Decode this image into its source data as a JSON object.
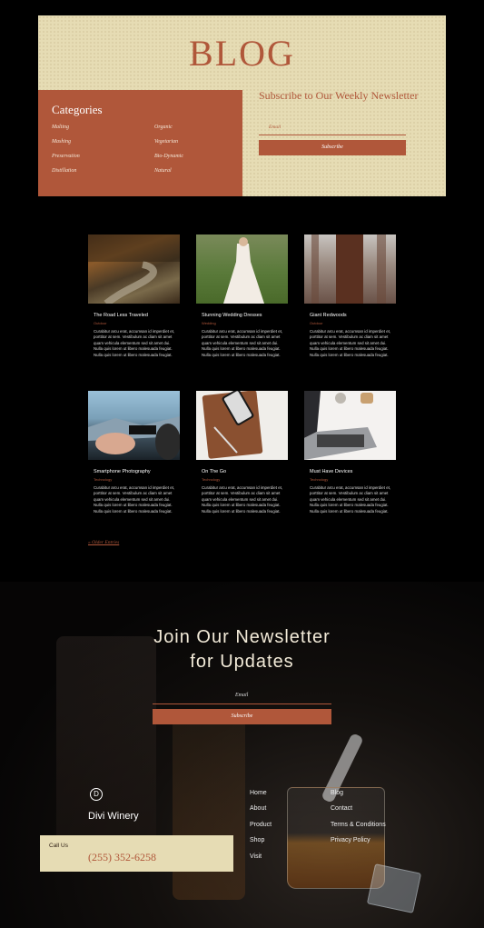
{
  "hero": {
    "title": "BLOG",
    "categories_title": "Categories",
    "categories": [
      "Malting",
      "Mashing",
      "Preservation",
      "Distillation",
      "Organic",
      "Vegetarian",
      "Bio-Dynamic",
      "Natural"
    ],
    "subscribe_title": "Subscribe to Our Weekly Newsletter",
    "email_placeholder": "Email",
    "subscribe_label": "Subscribe"
  },
  "posts": [
    {
      "title": "The Road Less Traveled",
      "category": "Outdoor",
      "image": "forest-path-photo"
    },
    {
      "title": "Stunning Wedding Dresses",
      "category": "Wedding",
      "image": "wedding-dress-photo"
    },
    {
      "title": "Giant Redwoods",
      "category": "Outdoor",
      "image": "redwood-forest-photo"
    },
    {
      "title": "Smartphone Photography",
      "category": "Technology",
      "image": "smartphone-photo"
    },
    {
      "title": "On The Go",
      "category": "Technology",
      "image": "phone-notebook-photo"
    },
    {
      "title": "Must Have Devices",
      "category": "Technology",
      "image": "laptop-photo"
    }
  ],
  "post_excerpt": "Curabitur arcu erat, accumsan id imperdiet et, porttitor at sem. Vestibulum ac diam sit amet quam vehicula elementum sed sit amet dui. Nulla quis lorem ut libero malesuada feugiat. Nulla quis lorem ut libero malesuada feugiat.",
  "older_entries": "« Older Entries",
  "newsletter": {
    "title_line1": "Join Our Newsletter",
    "title_line2": "for Updates",
    "email_placeholder": "Email",
    "subscribe_label": "Subscribe"
  },
  "footer": {
    "logo_letter": "D",
    "brand": "Divi Winery",
    "call_label": "Call Us",
    "phone": "(255) 352-6258",
    "links_col1": [
      "Home",
      "About",
      "Product",
      "Shop",
      "Visit"
    ],
    "links_col2": [
      "Blog",
      "Contact",
      "Terms & Conditions",
      "Privacy Policy"
    ]
  },
  "colors": {
    "accent": "#b0573a",
    "cream": "#e6dcb4",
    "background": "#000000"
  }
}
